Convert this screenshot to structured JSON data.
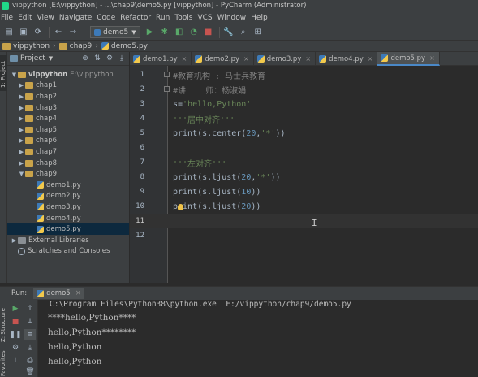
{
  "window": {
    "title": "vippython [E:\\vippython] - ...\\chap9\\demo5.py [vippython] - PyCharm (Administrator)"
  },
  "menu": [
    "File",
    "Edit",
    "View",
    "Navigate",
    "Code",
    "Refactor",
    "Run",
    "Tools",
    "VCS",
    "Window",
    "Help"
  ],
  "toolbar": {
    "run_config": "demo5",
    "icons": [
      "open-icon",
      "save-icon",
      "sync-icon",
      "back-icon",
      "forward-icon",
      "run-icon",
      "debug-icon",
      "coverage-icon",
      "profile-icon",
      "stop-icon",
      "settings-icon",
      "search-icon",
      "structure-icon"
    ]
  },
  "breadcrumb": {
    "project": "vippython",
    "folder": "chap9",
    "file": "demo5.py"
  },
  "side_tabs": {
    "project": "1: Project",
    "structure": "Z: Structure",
    "favorites": "Favorites"
  },
  "project_panel": {
    "title": "Project",
    "root": {
      "name": "vippython",
      "path": "E:\\vippython"
    },
    "folders": [
      "chap1",
      "chap2",
      "chap3",
      "chap4",
      "chap5",
      "chap6",
      "chap7",
      "chap8",
      "chap9"
    ],
    "files": [
      "demo1.py",
      "demo2.py",
      "demo3.py",
      "demo4.py",
      "demo5.py"
    ],
    "selected_file": "demo5.py",
    "external_libraries": "External Libraries",
    "scratches": "Scratches and Consoles"
  },
  "editor_tabs": [
    "demo1.py",
    "demo2.py",
    "demo3.py",
    "demo4.py",
    "demo5.py"
  ],
  "active_tab": "demo5.py",
  "code": {
    "line_numbers": [
      "1",
      "2",
      "3",
      "4",
      "5",
      "6",
      "7",
      "8",
      "9",
      "10",
      "11",
      "12"
    ],
    "l1": "#教育机构 : 马士兵教育",
    "l2": "#讲    师：杨淑娟",
    "l3_a": "s=",
    "l3_b": "'hello,Python'",
    "l4": "'''居中对齐'''",
    "l5_a": "print(s.center(",
    "l5_b": "20",
    "l5_c": ",",
    "l5_d": "'*'",
    "l5_e": "))",
    "l7": "'''左对齐'''",
    "l8_a": "print(s.ljust(",
    "l8_b": "20",
    "l8_c": ",",
    "l8_d": "'*'",
    "l8_e": "))",
    "l9_a": "print(s.ljust(",
    "l9_b": "10",
    "l9_c": "))",
    "l10_a": "print(s.ljust(",
    "l10_b": "20",
    "l10_c": "))",
    "caret": "I"
  },
  "run": {
    "label": "Run:",
    "tab": "demo5",
    "output": [
      "C:\\Program Files\\Python38\\python.exe  E:/vippython/chap9/demo5.py",
      "****hello,Python****",
      "hello,Python********",
      "hello,Python",
      "hello,Python"
    ]
  }
}
